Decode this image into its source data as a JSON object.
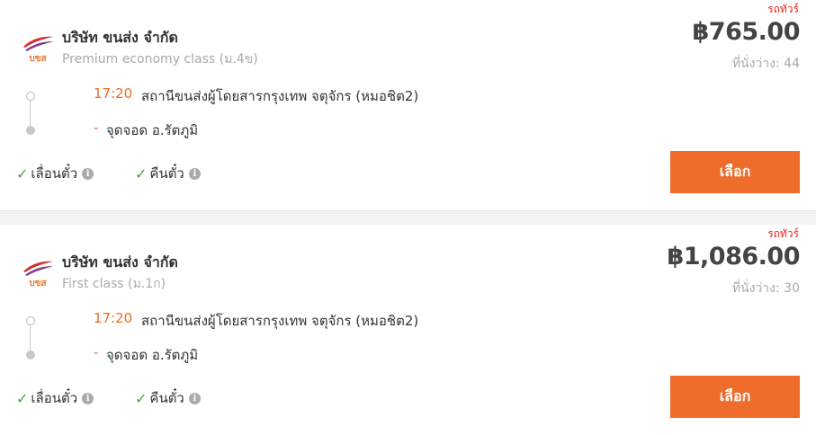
{
  "trips": [
    {
      "tag": "รถทัวร์",
      "company": "บริษัท ขนส่ง จำกัด",
      "seat_class": "Premium economy class (ม.4ข)",
      "price": "฿765.00",
      "seats": "ที่นั่งว่าง: 44",
      "departure_time": "17:20",
      "departure_station": "สถานีขนส่งผู้โดยสารกรุงเทพ จตุจักร (หมอชิต2)",
      "arrival_dash": "-",
      "arrival_station": "จุดจอด อ.รัตภูมิ",
      "feature1": "เลื่อนตั๋ว",
      "feature2": "คืนตั๋ว",
      "button": "เลือก"
    },
    {
      "tag": "รถทัวร์",
      "company": "บริษัท ขนส่ง จำกัด",
      "seat_class": "First class (ม.1ก)",
      "price": "฿1,086.00",
      "seats": "ที่นั่งว่าง: 30",
      "departure_time": "17:20",
      "departure_station": "สถานีขนส่งผู้โดยสารกรุงเทพ จตุจักร (หมอชิต2)",
      "arrival_dash": "-",
      "arrival_station": "จุดจอด อ.รัตภูมิ",
      "feature1": "เลื่อนตั๋ว",
      "feature2": "คืนตั๋ว",
      "button": "เลือก"
    }
  ],
  "logo_text": "บขส",
  "icons": {
    "check": "check-icon",
    "info": "info-icon"
  },
  "colors": {
    "accent": "#ef6c2b",
    "tag": "#e5251c",
    "check": "#4aa33f",
    "muted": "#aaaaaa"
  }
}
